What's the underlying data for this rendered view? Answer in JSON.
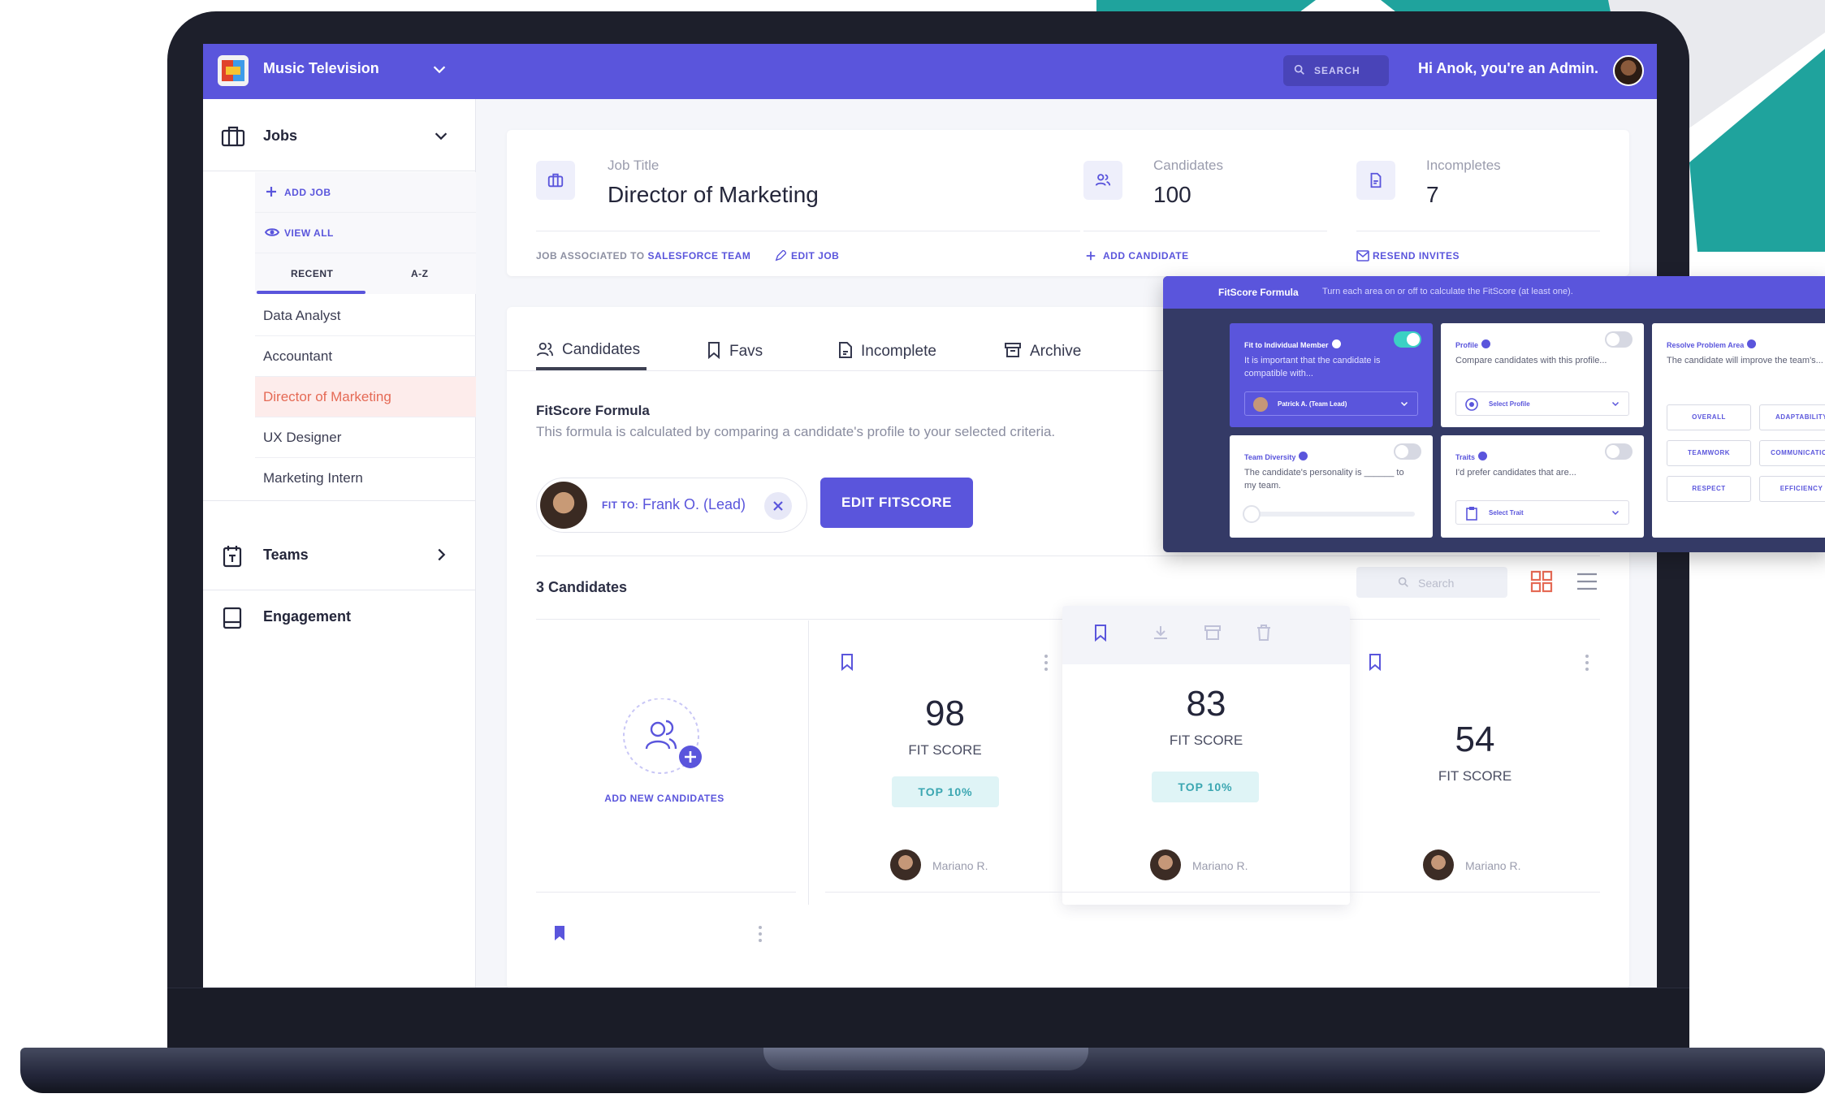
{
  "colors": {
    "brand": "#5a55dc",
    "accent_teal": "#3bd1c4",
    "active_item": "#e56a55"
  },
  "topbar": {
    "org_name": "Music Television",
    "search_label": "SEARCH",
    "greeting": "Hi Anok, you're an Admin."
  },
  "sidebar": {
    "jobs_label": "Jobs",
    "add_job": "ADD JOB",
    "view_all": "VIEW ALL",
    "tab_recent": "RECENT",
    "tab_az": "A-Z",
    "items": [
      {
        "label": "Data Analyst"
      },
      {
        "label": "Accountant"
      },
      {
        "label": "Director of Marketing"
      },
      {
        "label": "UX Designer"
      },
      {
        "label": "Marketing Intern"
      }
    ],
    "teams_label": "Teams",
    "engagement_label": "Engagement"
  },
  "job": {
    "title_label": "Job Title",
    "title": "Director of Marketing",
    "candidates_label": "Candidates",
    "candidates": "100",
    "incompletes_label": "Incompletes",
    "incompletes": "7",
    "assoc_prefix": "JOB ASSOCIATED TO",
    "assoc_team": "SALESFORCE TEAM",
    "edit_job": "EDIT JOB",
    "add_candidate": "ADD CANDIDATE",
    "resend_invites": "RESEND INVITES"
  },
  "tabs": [
    {
      "label": "Candidates"
    },
    {
      "label": "Favs"
    },
    {
      "label": "Incomplete"
    },
    {
      "label": "Archive"
    }
  ],
  "fitscore": {
    "title": "FitScore Formula",
    "description": "This formula is calculated by comparing a candidate's profile to your selected criteria.",
    "fit_to_prefix": "FIT TO:",
    "fit_to_name": "Frank O. (Lead)",
    "edit_button": "EDIT FITSCORE"
  },
  "candidates": {
    "count_label": "3 Candidates",
    "search_placeholder": "Search",
    "add_new": "ADD NEW CANDIDATES",
    "fit_score_label": "FIT SCORE",
    "cards": [
      {
        "score": "98",
        "badge": "TOP 10%",
        "name": "Mariano R."
      },
      {
        "score": "83",
        "badge": "TOP 10%",
        "name": "Mariano R."
      },
      {
        "score": "54",
        "badge": "",
        "name": "Mariano R."
      }
    ]
  },
  "overlay": {
    "title": "FitScore Formula",
    "subtitle": "Turn each area on or off to calculate the FitScore (at least one).",
    "cards": [
      {
        "title": "Fit to Individual Member",
        "desc": "It is important that the candidate is compatible with...",
        "select": "Patrick A. (Team Lead)"
      },
      {
        "title": "Profile",
        "desc": "Compare candidates with this profile...",
        "select": "Select Profile"
      },
      {
        "title": "Resolve Problem Area",
        "desc": "The candidate will improve the team's..."
      },
      {
        "title": "Team Diversity",
        "desc": "The candidate's personality is ______ to my team."
      },
      {
        "title": "Traits",
        "desc": "I'd prefer candidates that are...",
        "select": "Select Trait"
      }
    ],
    "problem_chips": [
      "OVERALL",
      "ADAPTABILITY",
      "TEAMWORK",
      "COMMUNICATION",
      "RESPECT",
      "EFFICIENCY"
    ]
  }
}
